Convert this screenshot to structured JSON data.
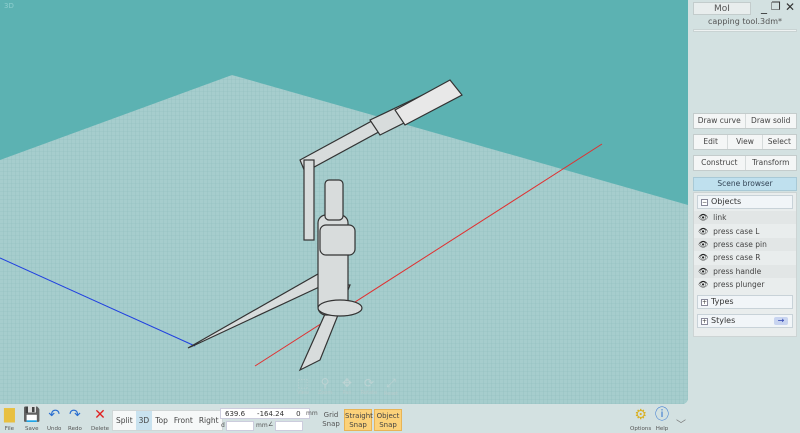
{
  "viewport": {
    "label": "3D",
    "axis_colors": {
      "x": "#e03030",
      "y": "#2040e0"
    },
    "nav": [
      {
        "icon": "view-icon",
        "label": "View"
      },
      {
        "icon": "zoom-icon",
        "label": "Zoom"
      },
      {
        "icon": "pan-icon",
        "label": "Pan"
      },
      {
        "icon": "rotate-icon",
        "label": "Rotate"
      },
      {
        "icon": "reset-icon",
        "label": "Reset"
      }
    ]
  },
  "panel": {
    "app": "MoI",
    "file": "capping tool.3dm*",
    "row1": [
      "Draw curve",
      "Draw solid"
    ],
    "row2": [
      "Edit",
      "View",
      "Select"
    ],
    "row3": [
      "Construct",
      "Transform"
    ],
    "scene_browser": "Scene browser",
    "objects_label": "Objects",
    "objects": [
      "link",
      "press case L",
      "press case pin",
      "press case R",
      "press handle",
      "press plunger"
    ],
    "types_label": "Types",
    "styles_label": "Styles"
  },
  "toolbar": {
    "file": "File",
    "save": "Save",
    "undo": "Undo",
    "redo": "Redo",
    "delete": "Delete",
    "views": [
      "Split",
      "3D",
      "Top",
      "Front",
      "Right"
    ],
    "active_view": "3D",
    "coords": {
      "x": "639.6",
      "y": "-164.24",
      "z": "0",
      "unit": "mm",
      "d_label": "d",
      "d_unit": "mm"
    },
    "grid_snap": [
      "Grid",
      "Snap"
    ],
    "straight_snap": [
      "Straight",
      "Snap"
    ],
    "object_snap": [
      "Object",
      "Snap"
    ],
    "options": "Options",
    "help": "Help"
  }
}
